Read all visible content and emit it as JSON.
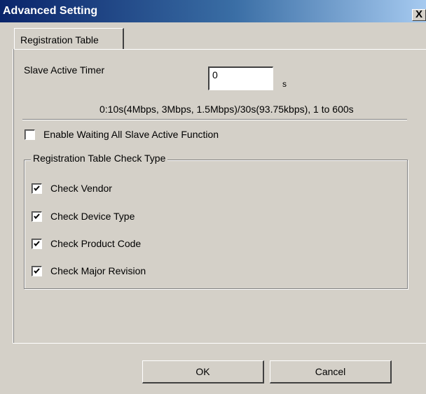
{
  "window": {
    "title": "Advanced Setting",
    "close_glyph": "X"
  },
  "tabs": [
    {
      "label": "Registration Table",
      "selected": true
    }
  ],
  "slave_active_timer": {
    "label": "Slave Active Timer",
    "value": "0",
    "unit": "s",
    "hint": "0:10s(4Mbps, 3Mbps, 1.5Mbps)/30s(93.75kbps), 1 to 600s"
  },
  "enable_waiting": {
    "label": "Enable Waiting All Slave Active Function",
    "checked": false
  },
  "check_type_group": {
    "title": "Registration Table Check Type",
    "items": [
      {
        "label": "Check Vendor",
        "checked": true
      },
      {
        "label": "Check Device Type",
        "checked": true
      },
      {
        "label": "Check Product Code",
        "checked": true
      },
      {
        "label": "Check Major Revision",
        "checked": true
      }
    ]
  },
  "buttons": {
    "ok_label": "OK",
    "cancel_label": "Cancel"
  }
}
